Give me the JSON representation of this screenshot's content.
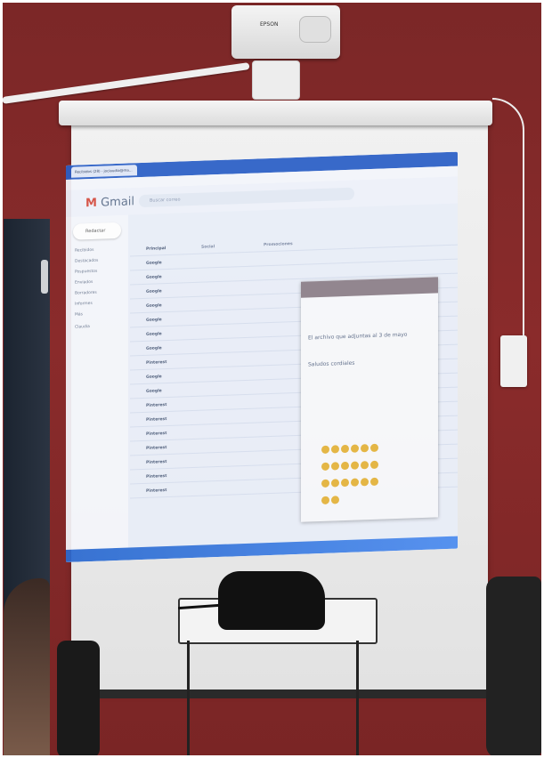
{
  "photo": {
    "projector_brand": "EPSON",
    "browser_tab": "Recibidos (28) - joclaudia@ma...",
    "gmail_logo": "Gmail",
    "search_placeholder": "Buscar correo",
    "compose": "Redactar",
    "nav_items": [
      "Recibidos",
      "Destacados",
      "Pospuestos",
      "Enviados",
      "Borradores",
      "Informes",
      "Más",
      "Claudia"
    ],
    "tabs": [
      "Principal",
      "Social",
      "Promociones"
    ],
    "senders": [
      "Google",
      "Google",
      "Google",
      "Google",
      "Google",
      "Google",
      "Google",
      "Pinterest",
      "Google",
      "Google",
      "Pinterest",
      "Pinterest",
      "Pinterest",
      "Pinterest",
      "Pinterest",
      "Pinterest",
      "Pinterest"
    ],
    "popup_lines": [
      "El archivo que adjuntas al 3 de mayo",
      "Saludos cordiales"
    ]
  },
  "colors": {
    "wall": "#7b2727",
    "screen": "#efefef",
    "gmail_blue": "#2b5fc7"
  }
}
